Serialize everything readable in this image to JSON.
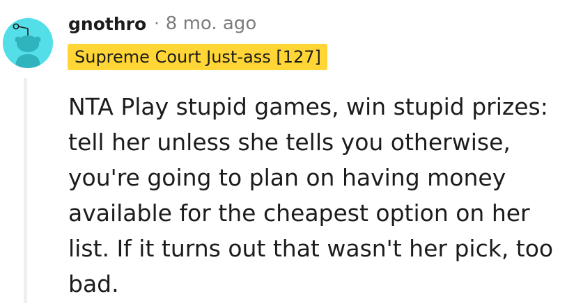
{
  "comment": {
    "author": "gnothro",
    "separator": "·",
    "age": "8 mo. ago",
    "flair": "Supreme Court Just-ass [127]",
    "body": "NTA Play stupid games, win stupid prizes: tell her unless she tells you otherwise, you're going to plan on having money available for the cheapest option on her list. If it turns out that wasn't her pick, too bad.",
    "avatar_icon": "snoo-avatar-icon"
  },
  "colors": {
    "avatar_background": "#54dfe8",
    "flair_background": "#ffd635",
    "meta_text": "#7c7c7c",
    "thread_line": "#edeff1"
  }
}
